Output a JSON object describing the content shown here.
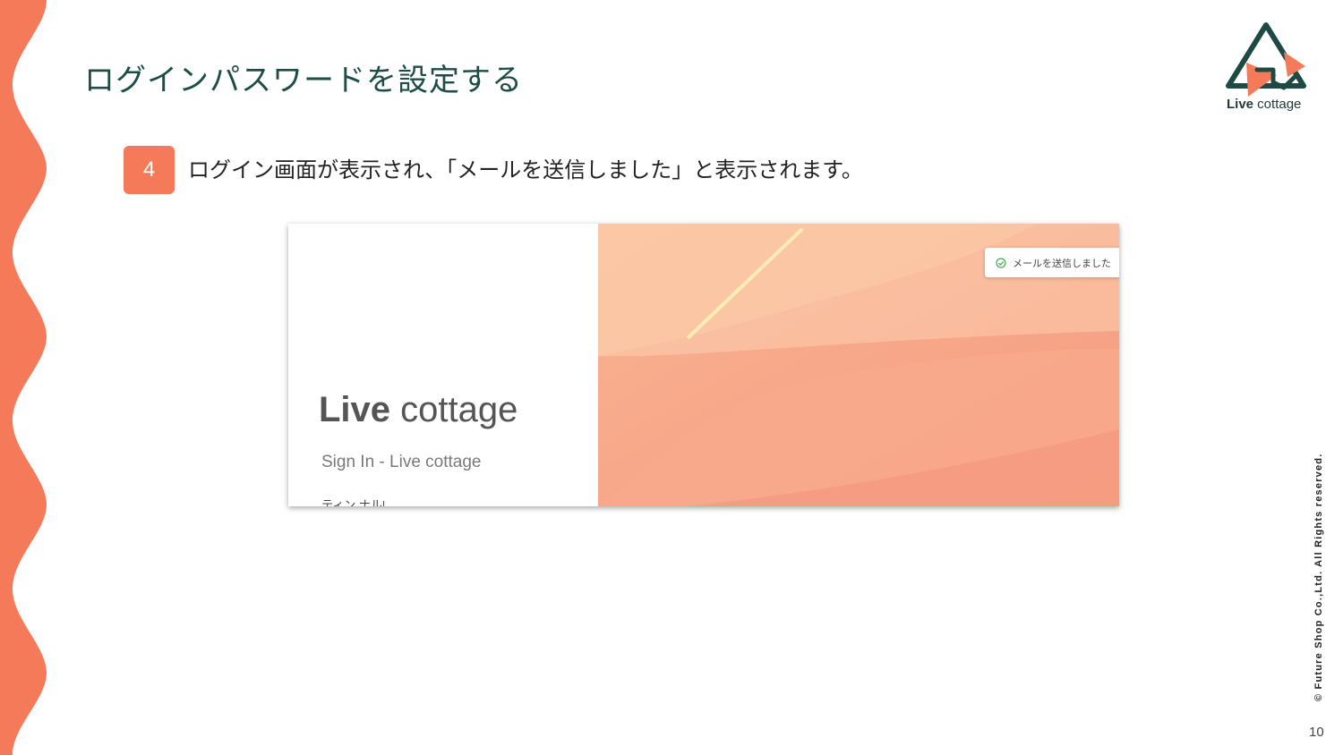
{
  "slide": {
    "title": "ログインパスワードを設定する",
    "step_number": "4",
    "step_text": "ログイン画面が表示され、「メールを送信しました」と表示されます。",
    "copyright": "© Future Shop Co.,Ltd. All Rights reserved.",
    "page_number": "10"
  },
  "logo": {
    "brand_bold": "Live",
    "brand_light": " cottage"
  },
  "screenshot": {
    "brand_bold": "Live",
    "brand_light": " cottage",
    "signin_text": "Sign In - Live cottage",
    "cut_label": "ティン ナルID",
    "toast_text": "メールを送信しました"
  },
  "colors": {
    "accent": "#f47a5a",
    "title": "#1d4d44",
    "toast_check": "#4caf50"
  },
  "icons": {
    "toast": "check-circle-icon",
    "logo": "house-logo-icon"
  }
}
